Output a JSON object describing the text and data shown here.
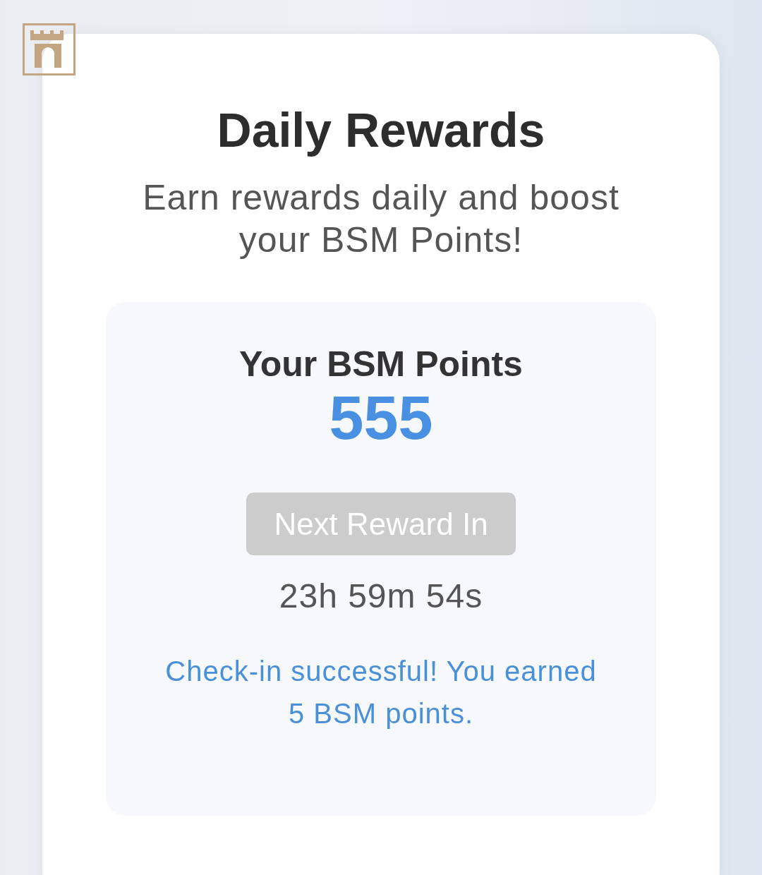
{
  "title": "Daily Rewards",
  "subtitle": "Earn rewards daily and boost your BSM Points!",
  "points": {
    "label": "Your BSM Points",
    "value": "555"
  },
  "next_button": {
    "label": "Next Reward In",
    "disabled": true
  },
  "countdown": "23h 59m 54s",
  "message": "Check-in successful! You earned 5 BSM points."
}
